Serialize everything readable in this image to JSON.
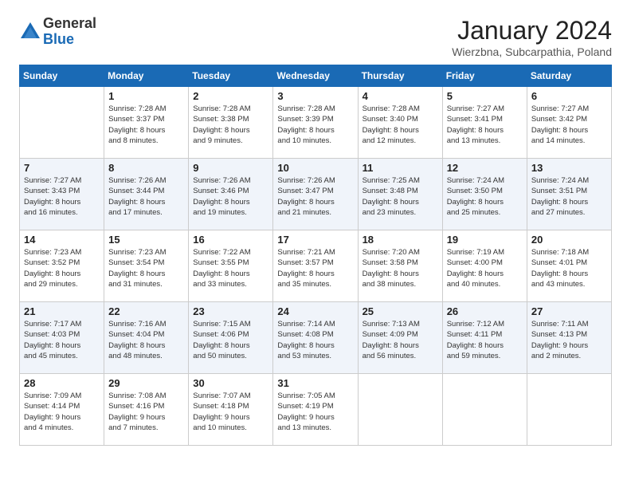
{
  "header": {
    "logo_general": "General",
    "logo_blue": "Blue",
    "month_title": "January 2024",
    "location": "Wierzbna, Subcarpathia, Poland"
  },
  "days_of_week": [
    "Sunday",
    "Monday",
    "Tuesday",
    "Wednesday",
    "Thursday",
    "Friday",
    "Saturday"
  ],
  "weeks": [
    [
      {
        "day": "",
        "info": ""
      },
      {
        "day": "1",
        "info": "Sunrise: 7:28 AM\nSunset: 3:37 PM\nDaylight: 8 hours\nand 8 minutes."
      },
      {
        "day": "2",
        "info": "Sunrise: 7:28 AM\nSunset: 3:38 PM\nDaylight: 8 hours\nand 9 minutes."
      },
      {
        "day": "3",
        "info": "Sunrise: 7:28 AM\nSunset: 3:39 PM\nDaylight: 8 hours\nand 10 minutes."
      },
      {
        "day": "4",
        "info": "Sunrise: 7:28 AM\nSunset: 3:40 PM\nDaylight: 8 hours\nand 12 minutes."
      },
      {
        "day": "5",
        "info": "Sunrise: 7:27 AM\nSunset: 3:41 PM\nDaylight: 8 hours\nand 13 minutes."
      },
      {
        "day": "6",
        "info": "Sunrise: 7:27 AM\nSunset: 3:42 PM\nDaylight: 8 hours\nand 14 minutes."
      }
    ],
    [
      {
        "day": "7",
        "info": "Sunrise: 7:27 AM\nSunset: 3:43 PM\nDaylight: 8 hours\nand 16 minutes."
      },
      {
        "day": "8",
        "info": "Sunrise: 7:26 AM\nSunset: 3:44 PM\nDaylight: 8 hours\nand 17 minutes."
      },
      {
        "day": "9",
        "info": "Sunrise: 7:26 AM\nSunset: 3:46 PM\nDaylight: 8 hours\nand 19 minutes."
      },
      {
        "day": "10",
        "info": "Sunrise: 7:26 AM\nSunset: 3:47 PM\nDaylight: 8 hours\nand 21 minutes."
      },
      {
        "day": "11",
        "info": "Sunrise: 7:25 AM\nSunset: 3:48 PM\nDaylight: 8 hours\nand 23 minutes."
      },
      {
        "day": "12",
        "info": "Sunrise: 7:24 AM\nSunset: 3:50 PM\nDaylight: 8 hours\nand 25 minutes."
      },
      {
        "day": "13",
        "info": "Sunrise: 7:24 AM\nSunset: 3:51 PM\nDaylight: 8 hours\nand 27 minutes."
      }
    ],
    [
      {
        "day": "14",
        "info": "Sunrise: 7:23 AM\nSunset: 3:52 PM\nDaylight: 8 hours\nand 29 minutes."
      },
      {
        "day": "15",
        "info": "Sunrise: 7:23 AM\nSunset: 3:54 PM\nDaylight: 8 hours\nand 31 minutes."
      },
      {
        "day": "16",
        "info": "Sunrise: 7:22 AM\nSunset: 3:55 PM\nDaylight: 8 hours\nand 33 minutes."
      },
      {
        "day": "17",
        "info": "Sunrise: 7:21 AM\nSunset: 3:57 PM\nDaylight: 8 hours\nand 35 minutes."
      },
      {
        "day": "18",
        "info": "Sunrise: 7:20 AM\nSunset: 3:58 PM\nDaylight: 8 hours\nand 38 minutes."
      },
      {
        "day": "19",
        "info": "Sunrise: 7:19 AM\nSunset: 4:00 PM\nDaylight: 8 hours\nand 40 minutes."
      },
      {
        "day": "20",
        "info": "Sunrise: 7:18 AM\nSunset: 4:01 PM\nDaylight: 8 hours\nand 43 minutes."
      }
    ],
    [
      {
        "day": "21",
        "info": "Sunrise: 7:17 AM\nSunset: 4:03 PM\nDaylight: 8 hours\nand 45 minutes."
      },
      {
        "day": "22",
        "info": "Sunrise: 7:16 AM\nSunset: 4:04 PM\nDaylight: 8 hours\nand 48 minutes."
      },
      {
        "day": "23",
        "info": "Sunrise: 7:15 AM\nSunset: 4:06 PM\nDaylight: 8 hours\nand 50 minutes."
      },
      {
        "day": "24",
        "info": "Sunrise: 7:14 AM\nSunset: 4:08 PM\nDaylight: 8 hours\nand 53 minutes."
      },
      {
        "day": "25",
        "info": "Sunrise: 7:13 AM\nSunset: 4:09 PM\nDaylight: 8 hours\nand 56 minutes."
      },
      {
        "day": "26",
        "info": "Sunrise: 7:12 AM\nSunset: 4:11 PM\nDaylight: 8 hours\nand 59 minutes."
      },
      {
        "day": "27",
        "info": "Sunrise: 7:11 AM\nSunset: 4:13 PM\nDaylight: 9 hours\nand 2 minutes."
      }
    ],
    [
      {
        "day": "28",
        "info": "Sunrise: 7:09 AM\nSunset: 4:14 PM\nDaylight: 9 hours\nand 4 minutes."
      },
      {
        "day": "29",
        "info": "Sunrise: 7:08 AM\nSunset: 4:16 PM\nDaylight: 9 hours\nand 7 minutes."
      },
      {
        "day": "30",
        "info": "Sunrise: 7:07 AM\nSunset: 4:18 PM\nDaylight: 9 hours\nand 10 minutes."
      },
      {
        "day": "31",
        "info": "Sunrise: 7:05 AM\nSunset: 4:19 PM\nDaylight: 9 hours\nand 13 minutes."
      },
      {
        "day": "",
        "info": ""
      },
      {
        "day": "",
        "info": ""
      },
      {
        "day": "",
        "info": ""
      }
    ]
  ]
}
